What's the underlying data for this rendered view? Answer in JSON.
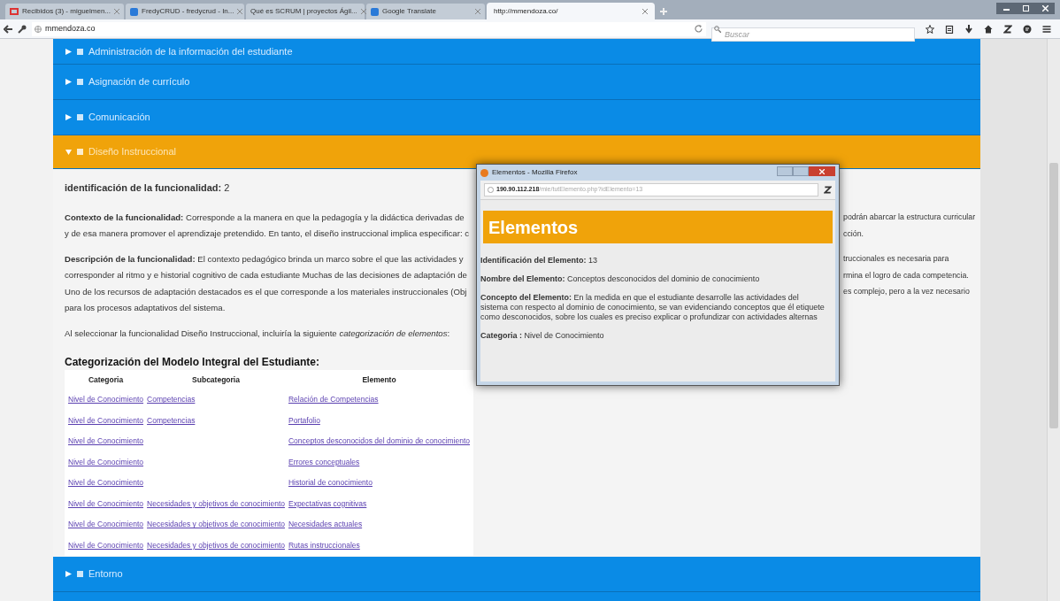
{
  "browser": {
    "tabs": [
      {
        "label": "Recibidos (3) - miguelmen...",
        "selected": false
      },
      {
        "label": "FredyCRUD - fredycrud - In...",
        "selected": false
      },
      {
        "label": "Qué es SCRUM | proyectos Ágil...",
        "selected": false
      },
      {
        "label": "Google Translate",
        "selected": false
      },
      {
        "label": "http://mmendoza.co/",
        "selected": true
      }
    ],
    "url": "mmendoza.co",
    "search": {
      "placeholder": "Buscar"
    }
  },
  "sections_before": [
    {
      "title": "Administración de la información del estudiante",
      "expanded": false
    },
    {
      "title": "Asignación de currículo",
      "expanded": false
    },
    {
      "title": "Comunicación",
      "expanded": false
    },
    {
      "title": "Diseño Instruccional",
      "expanded": true
    }
  ],
  "content": {
    "identification": "**identificación de la funcionalidad:** 2",
    "paragraphs": [
      {
        "lines": [
          {
            "left": "**Contexto de la funcionalidad:** Corresponde a la manera en que la pedagogía y la didáctica derivadas de",
            "right": "podrán abarcar la estructura curricular"
          },
          {
            "left": "y de esa manera promover el aprendizaje pretendido. En tanto, el diseño instruccional implica especificar: c",
            "right": "cción."
          }
        ]
      },
      {
        "lines": [
          {
            "left": "**Descripción de la funcionalidad:** El contexto pedagógico brinda un marco sobre el que las actividades y",
            "right": "truccionales es necesaria para"
          },
          {
            "left": "corresponder al ritmo y e historial cognitivo de cada estudiante Muchas de las decisiones de adaptación de",
            "right": "rmina el logro de cada competencia."
          },
          {
            "left": "Uno de los recursos de adaptación destacados es el que corresponde a los materiales instruccionales (Obj",
            "right": "es complejo, pero a la vez necesario"
          },
          {
            "left": "para los procesos adaptativos del sistema."
          }
        ]
      },
      {
        "lines": [
          {
            "left": "Al seleccionar la funcionalidad Diseño Instruccional, incluiría la siguiente *categorización de elementos*:"
          }
        ]
      }
    ],
    "table_title": "Categorización del Modelo Integral del Estudiante:",
    "table": {
      "columns": [
        "Categoria",
        "Subcategoria",
        "Elemento"
      ],
      "rows": [
        [
          "Nivel de Conocimiento",
          "Competencias",
          "Relación de Competencias"
        ],
        [
          "Nivel de Conocimiento",
          "Competencias",
          "Portafolio"
        ],
        [
          "Nivel de Conocimiento",
          "",
          "Conceptos desconocidos del dominio de conocimiento"
        ],
        [
          "Nivel de Conocimiento",
          "",
          "Errores conceptuales"
        ],
        [
          "Nivel de Conocimiento",
          "",
          "Historial de conocimiento"
        ],
        [
          "Nivel de Conocimiento",
          "Necesidades y objetivos de conocimiento",
          "Expectativas cognitivas"
        ],
        [
          "Nivel de Conocimiento",
          "Necesidades y objetivos de conocimiento",
          "Necesidades actuales"
        ],
        [
          "Nivel de Conocimiento",
          "Necesidades y objetivos de conocimiento",
          "Rutas instruccionales"
        ]
      ]
    }
  },
  "sections_after": [
    {
      "title": "Entorno",
      "expanded": false
    }
  ],
  "popup": {
    "window_title": "Elementos - Mozilla Firefox",
    "url_host": "190.90.112.218",
    "url_path": "/mie/tutElemento.php?idElemento=13",
    "heading": "Elementos",
    "fields": [
      {
        "text": "**Identificación del Elemento:** 13"
      },
      {
        "text": "**Nombre del Elemento:** Conceptos desconocidos del dominio de conocimiento"
      },
      {
        "text": "**Concepto del Elemento:** En la medida en que el estudiante desarrolle las actividades del sistema con respecto al dominio de conocimiento, se van evidenciando conceptos que él etiquete como desconocidos, sobre los cuales es preciso explicar o profundizar con actividades alternas"
      },
      {
        "text": "**Categoria :** Nivel de Conocimiento"
      }
    ]
  }
}
